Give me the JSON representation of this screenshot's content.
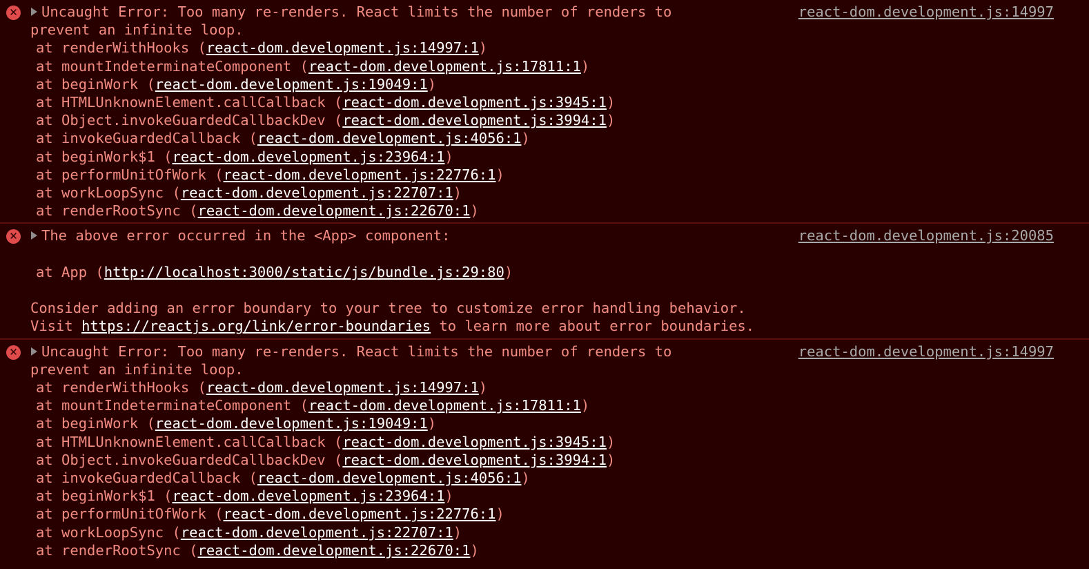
{
  "colors": {
    "background": "#290000",
    "error_text": "#f28b82",
    "link_text": "#ffffff",
    "source_link": "#a9a9a9",
    "divider": "#5c0f0f",
    "error_icon": "#e04b4b"
  },
  "entries": [
    {
      "icon": "error-icon",
      "source": "react-dom.development.js:14997",
      "message_line1": "Uncaught Error: Too many re-renders. React limits the number of renders to",
      "message_line2": "prevent an infinite loop.",
      "frames": [
        {
          "fn": "at renderWithHooks (",
          "link": "react-dom.development.js:14997:1",
          "close": ")"
        },
        {
          "fn": "at mountIndeterminateComponent (",
          "link": "react-dom.development.js:17811:1",
          "close": ")"
        },
        {
          "fn": "at beginWork (",
          "link": "react-dom.development.js:19049:1",
          "close": ")"
        },
        {
          "fn": "at HTMLUnknownElement.callCallback (",
          "link": "react-dom.development.js:3945:1",
          "close": ")"
        },
        {
          "fn": "at Object.invokeGuardedCallbackDev (",
          "link": "react-dom.development.js:3994:1",
          "close": ")"
        },
        {
          "fn": "at invokeGuardedCallback (",
          "link": "react-dom.development.js:4056:1",
          "close": ")"
        },
        {
          "fn": "at beginWork$1 (",
          "link": "react-dom.development.js:23964:1",
          "close": ")"
        },
        {
          "fn": "at performUnitOfWork (",
          "link": "react-dom.development.js:22776:1",
          "close": ")"
        },
        {
          "fn": "at workLoopSync (",
          "link": "react-dom.development.js:22707:1",
          "close": ")"
        },
        {
          "fn": "at renderRootSync (",
          "link": "react-dom.development.js:22670:1",
          "close": ")"
        }
      ]
    },
    {
      "icon": "error-icon",
      "source": "react-dom.development.js:20085",
      "message_line1": "The above error occurred in the <App> component:",
      "app_frame": {
        "fn": "at App (",
        "link": "http://localhost:3000/static/js/bundle.js:29:80",
        "close": ")"
      },
      "advice_line1": "Consider adding an error boundary to your tree to customize error handling behavior.",
      "advice_prefix": "Visit ",
      "advice_link": "https://reactjs.org/link/error-boundaries",
      "advice_suffix": " to learn more about error boundaries."
    },
    {
      "icon": "error-icon",
      "source": "react-dom.development.js:14997",
      "message_line1": "Uncaught Error: Too many re-renders. React limits the number of renders to",
      "message_line2": "prevent an infinite loop.",
      "frames": [
        {
          "fn": "at renderWithHooks (",
          "link": "react-dom.development.js:14997:1",
          "close": ")"
        },
        {
          "fn": "at mountIndeterminateComponent (",
          "link": "react-dom.development.js:17811:1",
          "close": ")"
        },
        {
          "fn": "at beginWork (",
          "link": "react-dom.development.js:19049:1",
          "close": ")"
        },
        {
          "fn": "at HTMLUnknownElement.callCallback (",
          "link": "react-dom.development.js:3945:1",
          "close": ")"
        },
        {
          "fn": "at Object.invokeGuardedCallbackDev (",
          "link": "react-dom.development.js:3994:1",
          "close": ")"
        },
        {
          "fn": "at invokeGuardedCallback (",
          "link": "react-dom.development.js:4056:1",
          "close": ")"
        },
        {
          "fn": "at beginWork$1 (",
          "link": "react-dom.development.js:23964:1",
          "close": ")"
        },
        {
          "fn": "at performUnitOfWork (",
          "link": "react-dom.development.js:22776:1",
          "close": ")"
        },
        {
          "fn": "at workLoopSync (",
          "link": "react-dom.development.js:22707:1",
          "close": ")"
        },
        {
          "fn": "at renderRootSync (",
          "link": "react-dom.development.js:22670:1",
          "close": ")"
        }
      ]
    }
  ]
}
